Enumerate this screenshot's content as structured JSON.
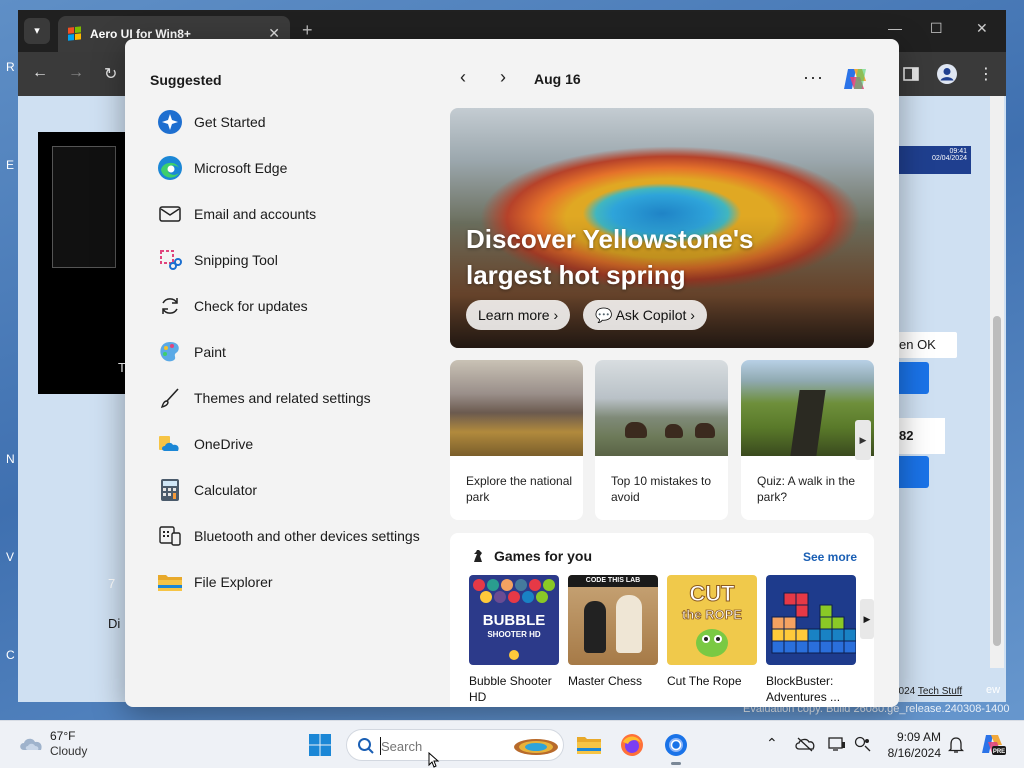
{
  "desktop": {
    "letters": [
      "R",
      "E",
      "N",
      "V",
      "C"
    ]
  },
  "browser": {
    "tab_title": "Aero UI for Win8+",
    "tab_close": "✕",
    "new_tab": "+",
    "window_controls": [
      "—",
      "☐",
      "✕"
    ],
    "nav": {
      "back": "←",
      "forward": "→",
      "reload": "↻"
    },
    "page": {
      "pip_text": "T",
      "mini_clock_time": "09:41",
      "mini_clock_date": "02/04/2024",
      "then_ok": "en OK",
      "card_value": "82",
      "side_text_di": "Di",
      "side_text_7": "7",
      "footer_note": "2024",
      "footer_link": "Tech Stuff",
      "footer_fragment": "ew"
    }
  },
  "evaluation_text": "Evaluation copy. Build 26080.ge_release.240308-1400",
  "widgets": {
    "suggested_title": "Suggested",
    "suggested": [
      {
        "label": "Get Started",
        "icon": "get-started-icon"
      },
      {
        "label": "Microsoft Edge",
        "icon": "edge-icon"
      },
      {
        "label": "Email and accounts",
        "icon": "mail-icon"
      },
      {
        "label": "Snipping Tool",
        "icon": "snipping-tool-icon"
      },
      {
        "label": "Check for updates",
        "icon": "sync-icon"
      },
      {
        "label": "Paint",
        "icon": "paint-icon"
      },
      {
        "label": "Themes and related settings",
        "icon": "brush-icon"
      },
      {
        "label": "OneDrive",
        "icon": "onedrive-icon"
      },
      {
        "label": "Calculator",
        "icon": "calculator-icon"
      },
      {
        "label": "Bluetooth and other devices settings",
        "icon": "devices-icon"
      },
      {
        "label": "File Explorer",
        "icon": "folder-icon"
      }
    ],
    "date": "Aug 16",
    "more": "···",
    "hero": {
      "title": "Discover Yellowstone's largest hot spring",
      "learn_more": "Learn more",
      "ask_copilot": "Ask Copilot"
    },
    "cards": [
      {
        "text": "Explore the national park"
      },
      {
        "text": "Top 10 mistakes to avoid"
      },
      {
        "text": "Quiz: A walk in the park?"
      }
    ],
    "games_title": "Games for you",
    "see_more": "See more",
    "games": [
      {
        "name": "Bubble Shooter HD",
        "logo_line1": "BUBBLE",
        "logo_line2": "SHOOTER HD"
      },
      {
        "name": "Master Chess",
        "logo_text": "CODE THIS LAB"
      },
      {
        "name": "Cut The Rope",
        "logo_line1": "CUT",
        "logo_line2": "the ROPE"
      },
      {
        "name": "BlockBuster: Adventures ..."
      }
    ]
  },
  "taskbar": {
    "weather_temp": "67°F",
    "weather_condition": "Cloudy",
    "search_placeholder": "Search",
    "time": "9:09 AM",
    "date": "8/16/2024"
  },
  "colors": {
    "accent": "#1a73e8",
    "link": "#1a5fb4",
    "panel_bg": "#f3f3f3"
  }
}
